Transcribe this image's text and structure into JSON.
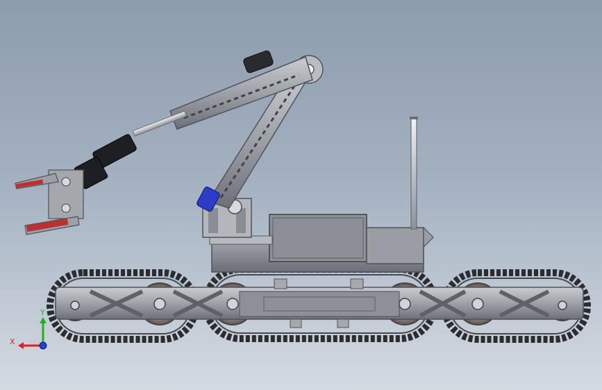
{
  "view": {
    "background_top": "#8d9cae",
    "background_bottom": "#d4dae2"
  },
  "colors": {
    "metal": "#9a9ea4",
    "metal_dark": "#5e6268",
    "metal_light": "#c4c8cd",
    "track": "#2b2d30",
    "wheel": "#8a7e7c",
    "gripper_pad": "#b83232",
    "blue_part": "#2a3cc8",
    "servo_black": "#1e1f22",
    "axis_x": "#e02020",
    "axis_y": "#20b020",
    "axis_z": "#2040e0"
  },
  "triad": {
    "x_label": "X",
    "y_label": "Y",
    "x_icon": "x-axis-arrow-icon",
    "y_icon": "y-axis-arrow-icon",
    "z_icon": "z-axis-dot-icon"
  }
}
